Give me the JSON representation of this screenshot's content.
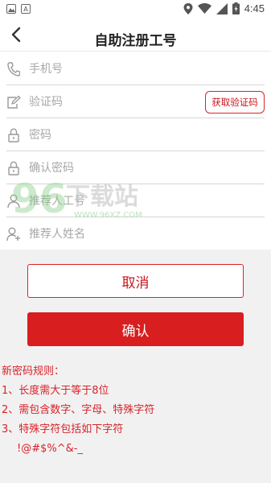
{
  "status_bar": {
    "time": "4:45",
    "left_icons": [
      "gallery-icon",
      "text-icon"
    ],
    "right_icons": [
      "location-icon",
      "wifi-icon",
      "signal-icon",
      "battery-icon"
    ]
  },
  "nav": {
    "title": "自助注册工号",
    "back_icon": "chevron-left-icon"
  },
  "form": {
    "phone": {
      "placeholder": "手机号",
      "icon": "phone-icon"
    },
    "code": {
      "placeholder": "验证码",
      "icon": "edit-icon",
      "button_label": "获取验证码"
    },
    "password": {
      "placeholder": "密码",
      "icon": "lock-icon"
    },
    "confirm_password": {
      "placeholder": "确认密码",
      "icon": "lock-icon"
    },
    "referrer_id": {
      "placeholder": "推荐人工号",
      "icon": "user-icon"
    },
    "referrer_name": {
      "placeholder": "推荐人姓名",
      "icon": "user-add-icon"
    }
  },
  "actions": {
    "cancel_label": "取消",
    "confirm_label": "确认"
  },
  "rules": {
    "title": "新密码规则：",
    "items": [
      "1、长度需大于等于8位",
      "2、需包含数字、字母、特殊字符",
      "3、特殊字符包括如下字符"
    ],
    "special_chars": "!@#$%^&-_"
  },
  "watermark": {
    "text": "下载站",
    "url": "WWW.96XZ.COM",
    "logo": "96"
  },
  "colors": {
    "accent": "#d81e1e",
    "panel_bg": "#f1f1f1",
    "placeholder": "#a8a8a8"
  }
}
